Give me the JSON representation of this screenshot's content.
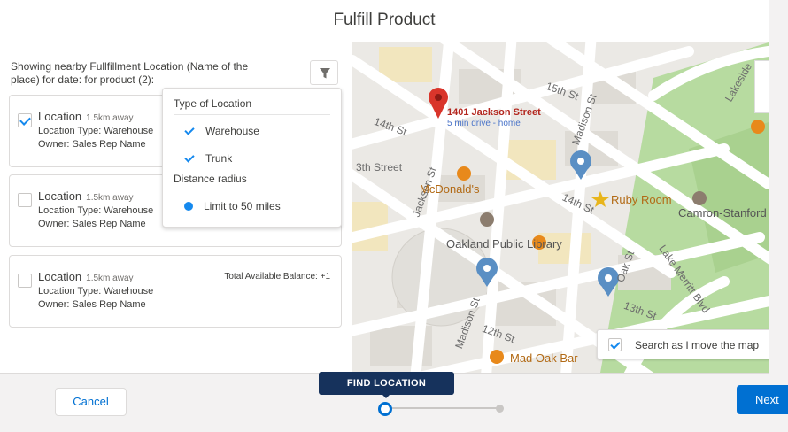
{
  "header": {
    "title": "Fulfill Product"
  },
  "left": {
    "description": "Showing nearby Fullfillment Location (Name of the place) for date: for product (2):",
    "filter_icon": "filter-icon"
  },
  "cards": [
    {
      "title": "Location",
      "distance": "1.5km away",
      "type": "Location Type: Warehouse",
      "owner": "Owner: Sales Rep Name",
      "checked": true,
      "balance": ""
    },
    {
      "title": "Location",
      "distance": "1.5km away",
      "type": "Location Type: Warehouse",
      "owner": "Owner: Sales Rep Name",
      "checked": false,
      "balance": ""
    },
    {
      "title": "Location",
      "distance": "1.5km away",
      "type": "Location Type: Warehouse",
      "owner": "Owner: Sales Rep Name",
      "checked": false,
      "balance": "Total Available Balance: +1"
    }
  ],
  "filter_dropdown": {
    "type_heading": "Type of Location",
    "options": [
      {
        "label": "Warehouse",
        "checked": true
      },
      {
        "label": "Trunk",
        "checked": true
      }
    ],
    "distance_heading": "Distance radius",
    "radius_label": "Limit to 50 miles"
  },
  "map": {
    "pin_title": "1401 Jackson Street",
    "pin_subtitle": "5 min drive - home",
    "streets": [
      "15th St",
      "14th St",
      "3th Street",
      "Jackson St",
      "Madison St",
      "14th St",
      "Oak St",
      "Lake Merritt Blvd",
      "13th St",
      "12th St",
      "Madison St",
      "Lakeside"
    ],
    "pois": [
      "McDonald's",
      "Ruby Room",
      "Camron-Stanford",
      "Oakland Public Library",
      "Mad Oak Bar"
    ],
    "search_toggle_label": "Search as I move the map"
  },
  "footer": {
    "cancel_label": "Cancel",
    "next_label": "Next",
    "step_tooltip": "FIND LOCATION"
  },
  "colors": {
    "brand": "#0070d2",
    "tooltip": "#16325c",
    "pin": "#d9352b",
    "map_pin": "#5a8fc4"
  }
}
